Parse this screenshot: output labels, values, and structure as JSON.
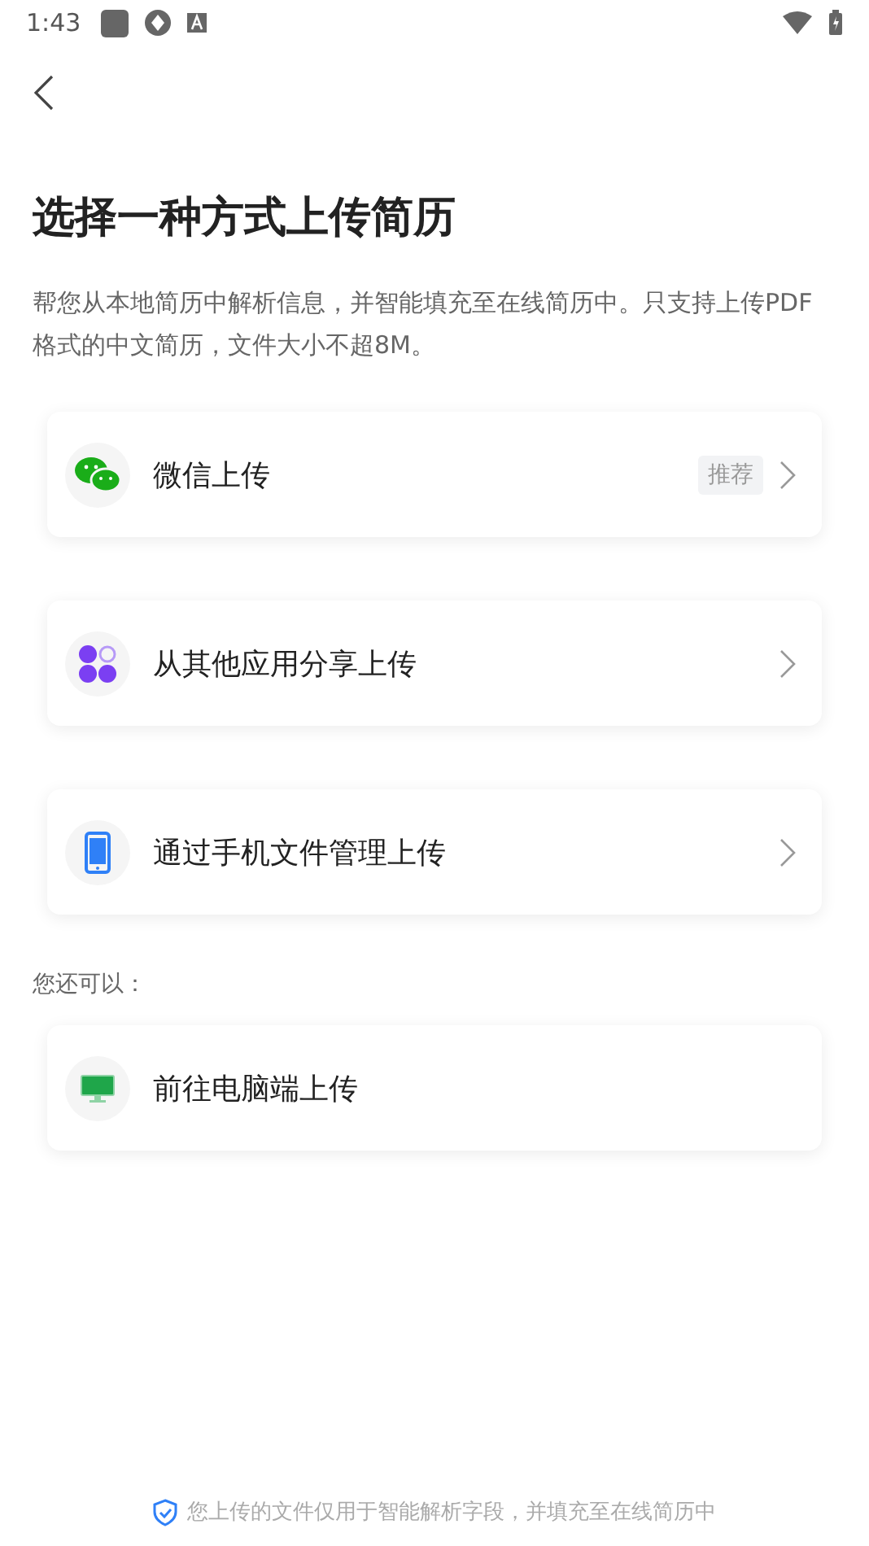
{
  "status_bar": {
    "time": "1:43"
  },
  "title": "选择一种方式上传简历",
  "description": "帮您从本地简历中解析信息，并智能填充至在线简历中。只支持上传PDF格式的中文简历，文件大小不超8M。",
  "options": [
    {
      "kind": "wechat",
      "label": "微信上传",
      "badge": "推荐",
      "arrow": true
    },
    {
      "kind": "apps",
      "label": "从其他应用分享上传",
      "arrow": true
    },
    {
      "kind": "phone",
      "label": "通过手机文件管理上传",
      "arrow": true
    }
  ],
  "more_label": "您还可以：",
  "more_options": [
    {
      "kind": "computer",
      "label": "前往电脑端上传",
      "arrow": false
    }
  ],
  "footer": "您上传的文件仅用于智能解析字段，并填充至在线简历中"
}
